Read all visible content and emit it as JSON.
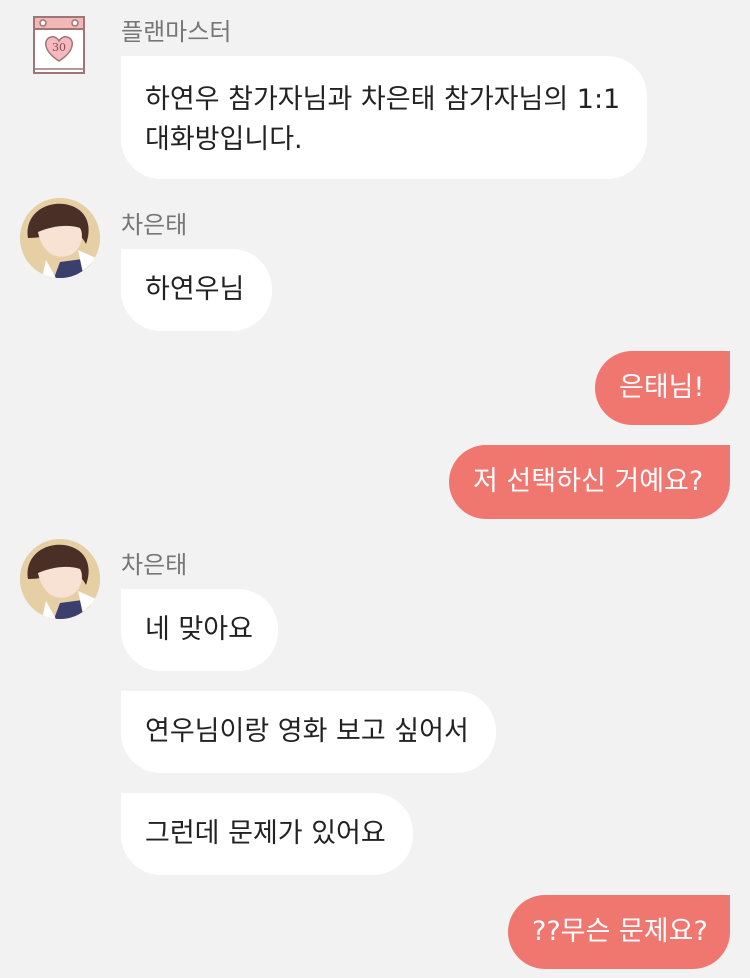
{
  "messages": [
    {
      "sender": "플랜마스터",
      "text_lines": [
        "하연우 참가자님과 차은태 참가자님의 1:1",
        "대화방입니다."
      ],
      "calendar_number": "30"
    },
    {
      "sender": "차은태",
      "text": "하연우님"
    },
    {
      "text": "은태님!"
    },
    {
      "text": "저 선택하신 거예요?"
    },
    {
      "sender": "차은태",
      "text": "네 맞아요"
    },
    {
      "text": "연우님이랑 영화 보고 싶어서"
    },
    {
      "text": "그런데 문제가 있어요"
    },
    {
      "text": "??무슨 문제요?"
    }
  ],
  "colors": {
    "outgoing_bubble": "#f07670",
    "incoming_bubble": "#ffffff",
    "background": "#f2f2f2"
  }
}
